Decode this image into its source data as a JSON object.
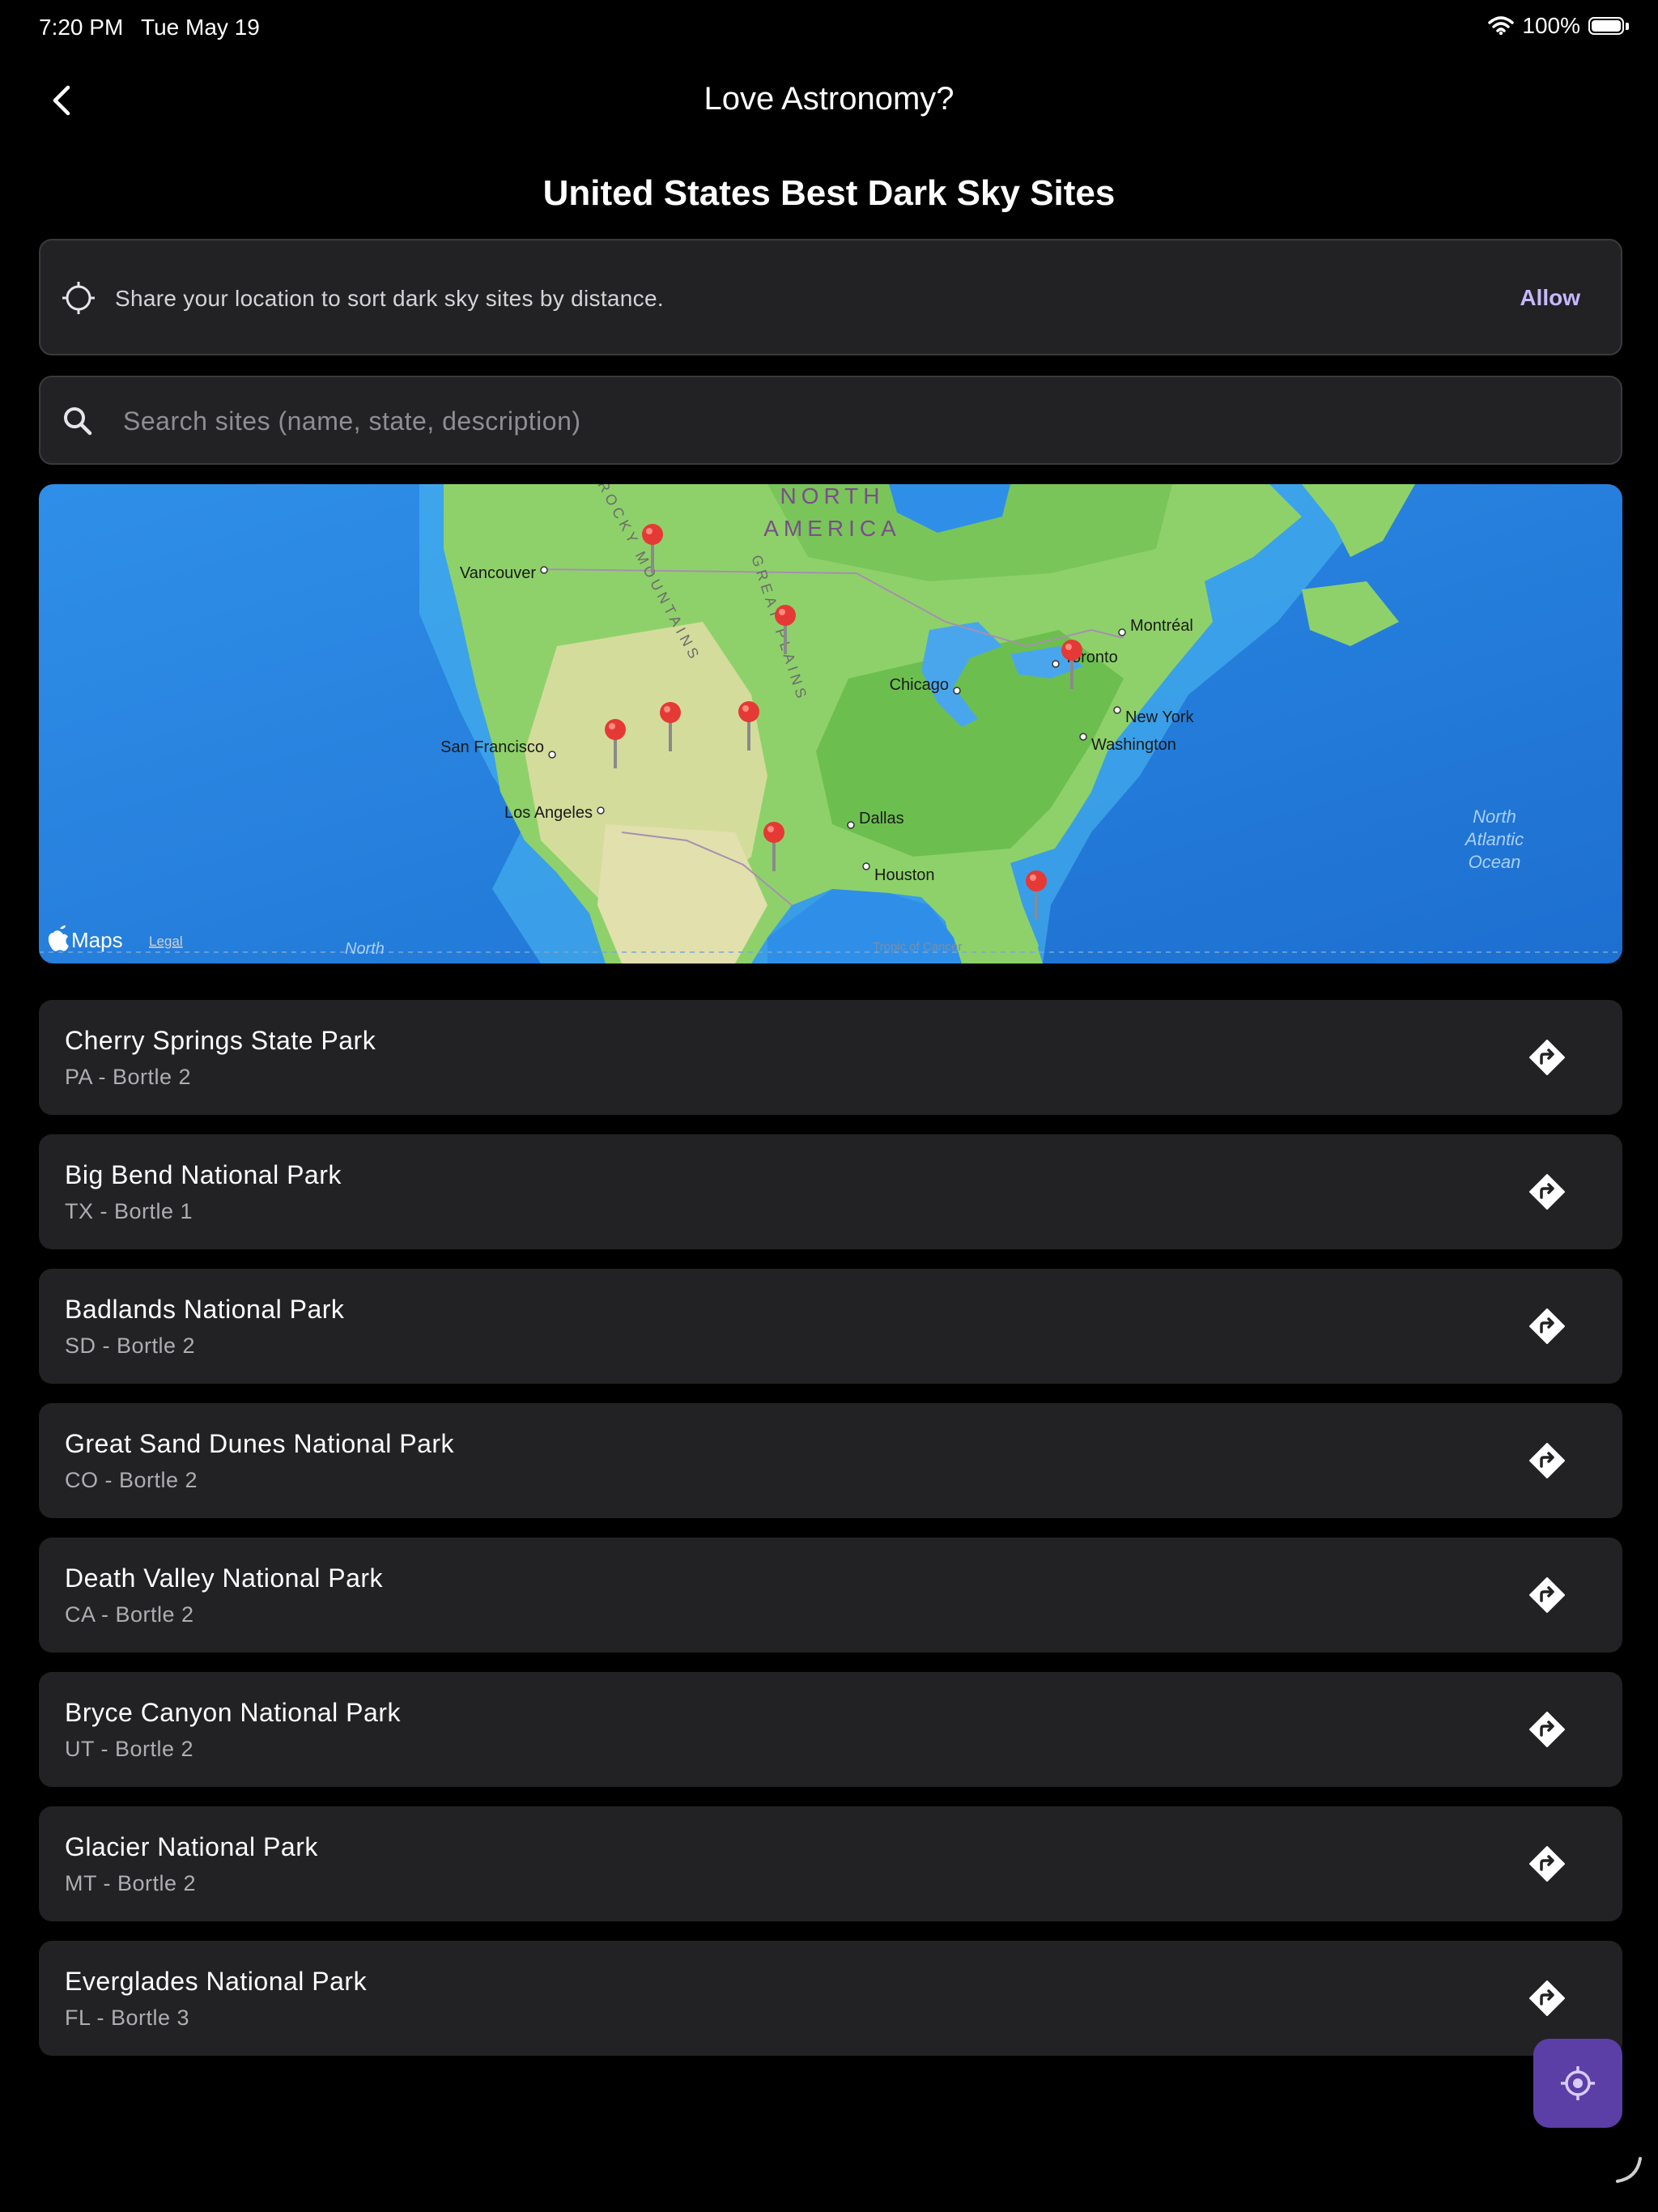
{
  "status_bar": {
    "time": "7:20 PM",
    "date": "Tue May 19",
    "battery": "100%"
  },
  "nav": {
    "title": "Love Astronomy?",
    "back_icon": "chevron-left-icon"
  },
  "heading": "United States Best Dark Sky Sites",
  "location_prompt": {
    "text": "Share your location to sort dark sky sites by distance.",
    "action": "Allow",
    "icon": "crosshair-icon"
  },
  "search": {
    "placeholder": "Search sites (name, state, description)",
    "value": ""
  },
  "map": {
    "region_title_1": "NORTH",
    "region_title_2": "AMERICA",
    "range_label_1": "ROCKY MOUNTAINS",
    "range_label_2": "GREAT PLAINS",
    "ocean_1": "North",
    "ocean_2": "Atlantic",
    "ocean_3": "Ocean",
    "bottom_label": "North",
    "tropic_label": "Tropic of Cancer",
    "brand": "Maps",
    "legal": "Legal",
    "cities": [
      "Vancouver",
      "Montréal",
      "Toronto",
      "Chicago",
      "New York",
      "Washington",
      "San Francisco",
      "Los Angeles",
      "Dallas",
      "Houston"
    ]
  },
  "sites": [
    {
      "name": "Cherry Springs State Park",
      "meta": "PA - Bortle 2"
    },
    {
      "name": "Big Bend National Park",
      "meta": "TX - Bortle 1"
    },
    {
      "name": "Badlands National Park",
      "meta": "SD - Bortle 2"
    },
    {
      "name": "Great Sand Dunes National Park",
      "meta": "CO - Bortle 2"
    },
    {
      "name": "Death Valley National Park",
      "meta": "CA - Bortle 2"
    },
    {
      "name": "Bryce Canyon National Park",
      "meta": "UT - Bortle 2"
    },
    {
      "name": "Glacier National Park",
      "meta": "MT - Bortle 2"
    },
    {
      "name": "Everglades National Park",
      "meta": "FL - Bortle 3"
    }
  ],
  "colors": {
    "accent": "#c7b8ff",
    "fab": "#5b3fa6",
    "card": "#222224",
    "pin": "#e53935"
  }
}
